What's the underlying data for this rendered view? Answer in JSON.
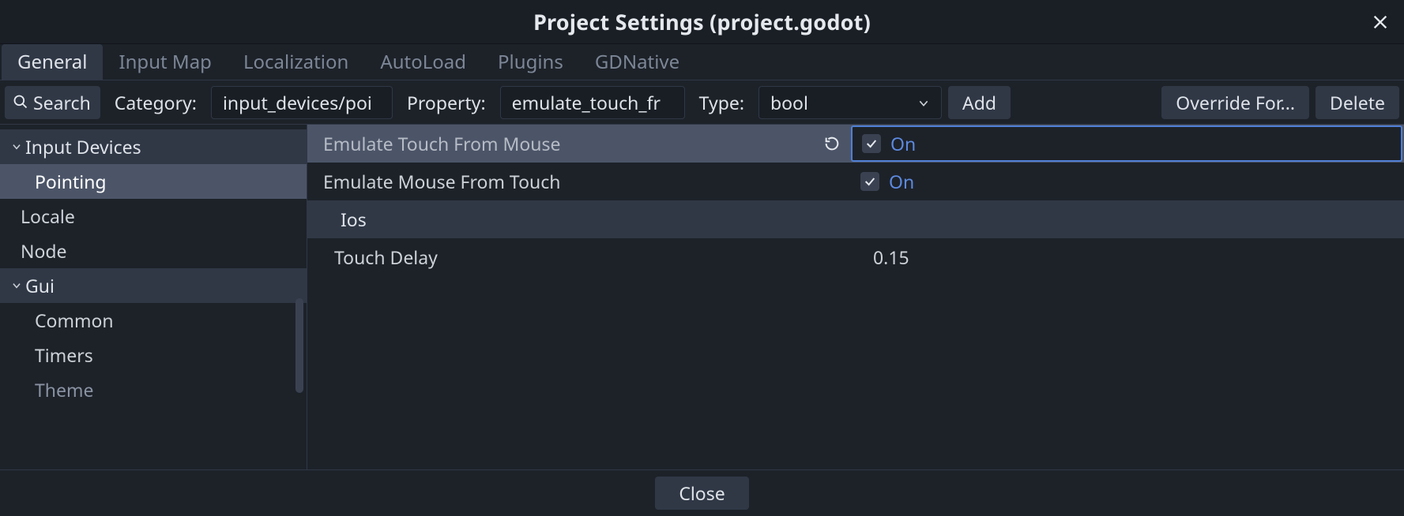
{
  "window": {
    "title": "Project Settings (project.godot)"
  },
  "tabs": {
    "items": [
      "General",
      "Input Map",
      "Localization",
      "AutoLoad",
      "Plugins",
      "GDNative"
    ],
    "active": 0
  },
  "filter": {
    "search_label": "Search",
    "category_label": "Category:",
    "category_value": "input_devices/poi",
    "property_label": "Property:",
    "property_value": "emulate_touch_fr",
    "type_label": "Type:",
    "type_value": "bool",
    "add_label": "Add",
    "override_label": "Override For...",
    "delete_label": "Delete"
  },
  "tree": {
    "items": [
      {
        "label": "Input Devices",
        "kind": "header",
        "expanded": true
      },
      {
        "label": "Pointing",
        "kind": "child",
        "selected": true
      },
      {
        "label": "Locale",
        "kind": "item"
      },
      {
        "label": "Node",
        "kind": "item"
      },
      {
        "label": "Gui",
        "kind": "header",
        "expanded": true
      },
      {
        "label": "Common",
        "kind": "child"
      },
      {
        "label": "Timers",
        "kind": "child"
      },
      {
        "label": "Theme",
        "kind": "child",
        "partial": true
      }
    ]
  },
  "props": {
    "rows": [
      {
        "label": "Emulate Touch From Mouse",
        "type": "bool",
        "value": "On",
        "checked": true,
        "revert": true,
        "highlight": true
      },
      {
        "label": "Emulate Mouse From Touch",
        "type": "bool",
        "value": "On",
        "checked": true
      },
      {
        "label": "Ios",
        "type": "section"
      },
      {
        "label": "Touch Delay",
        "type": "number",
        "value": "0.15"
      }
    ]
  },
  "footer": {
    "close_label": "Close"
  }
}
